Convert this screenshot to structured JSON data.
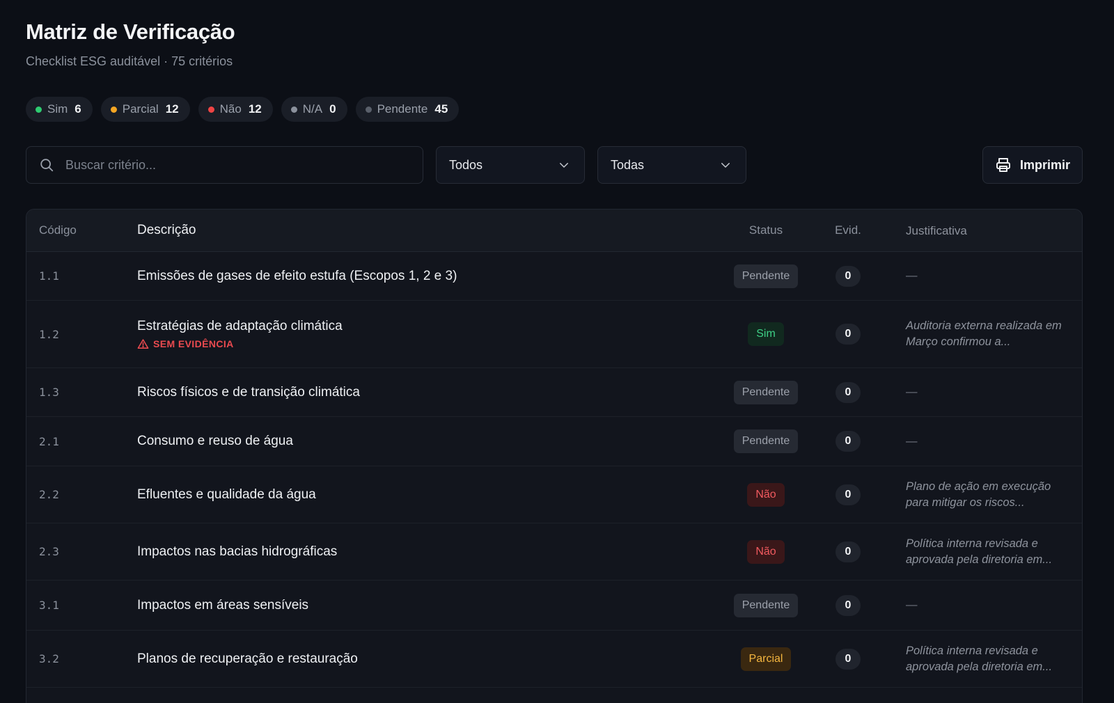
{
  "header": {
    "title": "Matriz de Verificação",
    "subtitle": "Checklist ESG auditável · 75 critérios"
  },
  "summary": [
    {
      "label": "Sim",
      "count": "6",
      "color": "#2ecc71"
    },
    {
      "label": "Parcial",
      "count": "12",
      "color": "#f5a623"
    },
    {
      "label": "Não",
      "count": "12",
      "color": "#ef4444"
    },
    {
      "label": "N/A",
      "count": "0",
      "color": "#8b919c"
    },
    {
      "label": "Pendente",
      "count": "45",
      "color": "#5a606b"
    }
  ],
  "toolbar": {
    "search_placeholder": "Buscar critério...",
    "filter_status": "Todos",
    "filter_category": "Todas",
    "print_label": "Imprimir"
  },
  "table": {
    "columns": {
      "code": "Código",
      "description": "Descrição",
      "status": "Status",
      "evidence": "Evid.",
      "justification": "Justificativa"
    },
    "rows": [
      {
        "code": "1.1",
        "description": "Emissões de gases de efeito estufa (Escopos 1, 2 e 3)",
        "status": "Pendente",
        "status_key": "pend",
        "evidence": "0",
        "justification": "—",
        "warning": ""
      },
      {
        "code": "1.2",
        "description": "Estratégias de adaptação climática",
        "status": "Sim",
        "status_key": "sim",
        "evidence": "0",
        "justification": "Auditoria externa realizada em Março confirmou a...",
        "warning": "SEM EVIDÊNCIA"
      },
      {
        "code": "1.3",
        "description": "Riscos físicos e de transição climática",
        "status": "Pendente",
        "status_key": "pend",
        "evidence": "0",
        "justification": "—",
        "warning": ""
      },
      {
        "code": "2.1",
        "description": "Consumo e reuso de água",
        "status": "Pendente",
        "status_key": "pend",
        "evidence": "0",
        "justification": "—",
        "warning": ""
      },
      {
        "code": "2.2",
        "description": "Efluentes e qualidade da água",
        "status": "Não",
        "status_key": "nao",
        "evidence": "0",
        "justification": "Plano de ação em execução para mitigar os riscos...",
        "warning": ""
      },
      {
        "code": "2.3",
        "description": "Impactos nas bacias hidrográficas",
        "status": "Não",
        "status_key": "nao",
        "evidence": "0",
        "justification": "Política interna revisada e aprovada pela diretoria em...",
        "warning": ""
      },
      {
        "code": "3.1",
        "description": "Impactos em áreas sensíveis",
        "status": "Pendente",
        "status_key": "pend",
        "evidence": "0",
        "justification": "—",
        "warning": ""
      },
      {
        "code": "3.2",
        "description": "Planos de recuperação e restauração",
        "status": "Parcial",
        "status_key": "parc",
        "evidence": "0",
        "justification": "Política interna revisada e aprovada pela diretoria em...",
        "warning": ""
      }
    ]
  }
}
